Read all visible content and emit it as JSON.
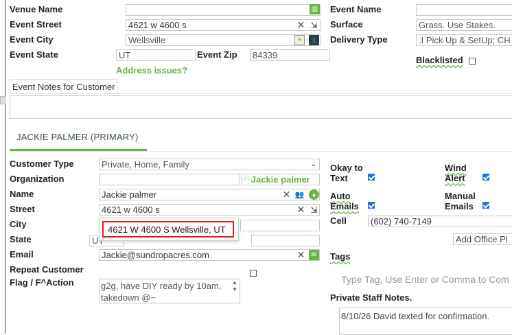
{
  "venue": {
    "venue_name_label": "Venue Name",
    "event_street_label": "Event Street",
    "event_street_value": "4621 w 4600 s",
    "event_city_label": "Event City",
    "event_city_value": "Wellsville",
    "event_state_label": "Event State",
    "event_state_value": "UT",
    "event_zip_label": "Event Zip",
    "event_zip_value": "84339",
    "address_issues_link": "Address issues?"
  },
  "event": {
    "event_name_label": "Event Name",
    "surface_label": "Surface",
    "surface_value": "Grass. Use Stakes.",
    "delivery_type_label": "Delivery Type",
    "delivery_type_value": ".I Pick Up & SetUp; CH",
    "blacklisted_label": "Blacklisted"
  },
  "notes": {
    "tab_label": "Event Notes for Customer"
  },
  "customer_tab": {
    "label": "JACKIE PALMER (PRIMARY)"
  },
  "customer": {
    "type_label": "Customer Type",
    "type_value": "Private, Home, Family",
    "organization_label": "Organization",
    "organization_link": "Jackie palmer",
    "name_label": "Name",
    "name_value": "Jackie palmer",
    "street_label": "Street",
    "street_value": "4621 w 4600 s",
    "city_label": "City",
    "state_label": "State",
    "state_value": "UT",
    "email_label": "Email",
    "email_value": "Jackie@sundropacres.com",
    "repeat_label": "Repeat Customer",
    "flag_label": "Flag / F^Action",
    "flag_value": "g2g, have DIY ready by 10am, takedown @~",
    "suggestion": "4621 W 4600 S Wellsville, UT"
  },
  "contact": {
    "okay_text_label_1": "Okay to",
    "okay_text_label_2": "Text",
    "wind_alert_label_1": "Wind",
    "wind_alert_label_2": "Alert",
    "auto_emails_label_1": "Auto",
    "auto_emails_label_2": "Emails",
    "manual_emails_label_1": "Manual",
    "manual_emails_label_2": "Emails",
    "cell_label": "Cell",
    "cell_value": "(602) 740-7149",
    "add_office_label": "Add Office Pl",
    "tags_label": "Tags",
    "tags_placeholder": "Type Tag, Use Enter or Comma to Com",
    "private_notes_label": "Private Staff Notes.",
    "private_notes_value": "8/10/26 David texted for confirmation."
  },
  "colors": {
    "accent_green": "#6ab344",
    "checkbox_blue": "#1a73e8",
    "highlight_red": "#e02020"
  }
}
